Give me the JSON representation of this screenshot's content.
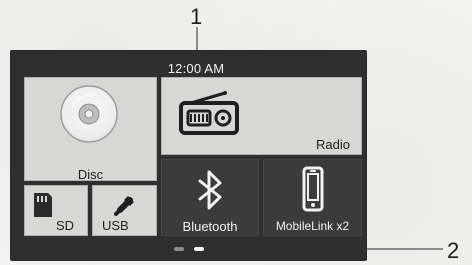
{
  "callouts": {
    "top": "1",
    "right": "2"
  },
  "status_bar": {
    "time": "12:00 AM"
  },
  "tiles": {
    "disc": {
      "label": "Disc",
      "icon": "disc-icon"
    },
    "radio": {
      "label": "Radio",
      "icon": "radio-icon"
    },
    "sd": {
      "label": "SD",
      "icon": "sd-card-icon"
    },
    "usb": {
      "label": "USB",
      "icon": "usb-icon"
    },
    "bluetooth": {
      "label": "Bluetooth",
      "icon": "bluetooth-icon"
    },
    "mobilelink": {
      "label": "MobileLink x2",
      "icon": "smartphone-icon"
    }
  },
  "pager": {
    "pages": 2,
    "active_index": 1
  },
  "colors": {
    "screen_bg": "#2f2f2f",
    "tile_bg": "#d7d7d5",
    "tile_dark_bg": "#3b3b3b",
    "active_indicator": "#f4f4f4"
  }
}
